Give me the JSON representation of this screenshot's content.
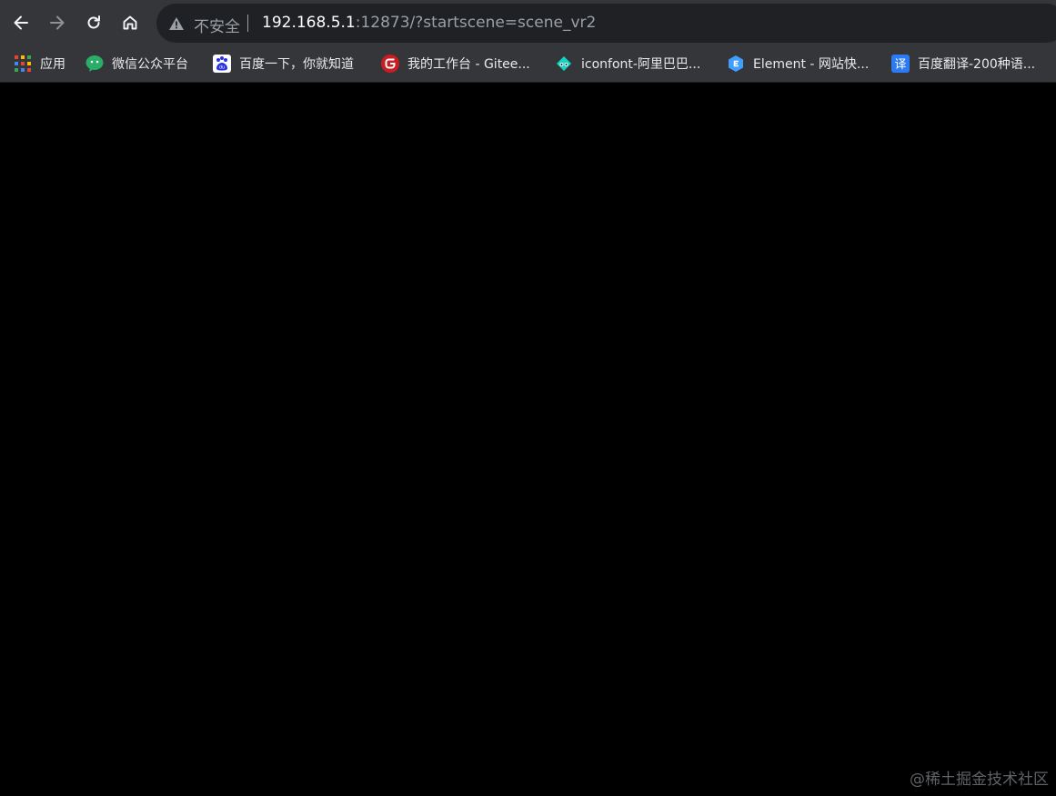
{
  "toolbar": {
    "back_icon": "arrow-left-icon",
    "forward_icon": "arrow-right-icon",
    "reload_icon": "reload-icon",
    "home_icon": "home-icon"
  },
  "omnibox": {
    "security_label": "不安全",
    "url_host": "192.168.5.1",
    "url_rest": ":12873/?startscene=scene_vr2"
  },
  "bookmarks": [
    {
      "label": "应用",
      "icon": "apps-grid-icon"
    },
    {
      "label": "微信公众平台",
      "icon": "wechat-icon"
    },
    {
      "label": "百度一下，你就知道",
      "icon": "baidu-icon"
    },
    {
      "label": "我的工作台 - Gitee...",
      "icon": "gitee-icon"
    },
    {
      "label": "iconfont-阿里巴巴...",
      "icon": "iconfont-icon"
    },
    {
      "label": "Element - 网站快...",
      "icon": "element-icon"
    },
    {
      "label": "百度翻译-200种语...",
      "icon": "baidu-translate-icon"
    }
  ],
  "watermark": "@稀土掘金技术社区",
  "colors": {
    "toolbar_bg": "#35363a",
    "omnibox_bg": "#202124",
    "page_bg": "#000000",
    "text_primary": "#ffffff",
    "text_secondary": "#9aa0a6"
  }
}
